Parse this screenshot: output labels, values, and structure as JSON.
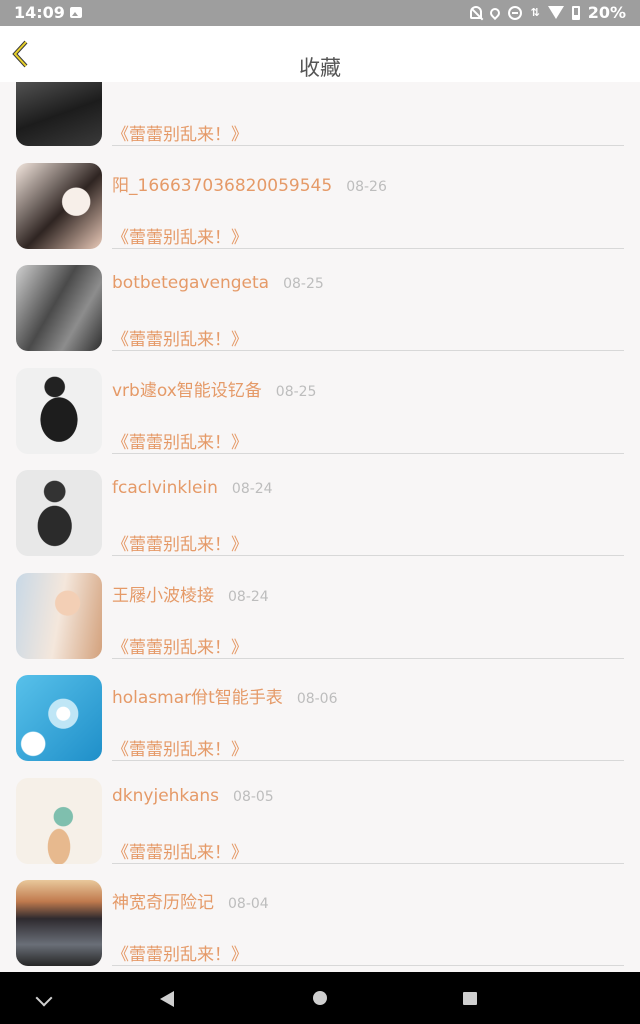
{
  "status": {
    "time": "14:09",
    "battery": "20%"
  },
  "header": {
    "title": "收藏"
  },
  "items": [
    {
      "name": "",
      "date": "",
      "link": "《蕾蕾别乱来！》",
      "avatar_colors": [
        "#2b2b2b",
        "#5a5a5a"
      ]
    },
    {
      "name": "阳_166637036820059545",
      "date": "08-26",
      "link": "《蕾蕾别乱来！》",
      "avatar_colors": [
        "#f1e6df",
        "#3a2e2b"
      ]
    },
    {
      "name": "botbetegavengeta",
      "date": "08-25",
      "link": "《蕾蕾别乱来！》",
      "avatar_colors": [
        "#cfcfcf",
        "#3d3d3d"
      ]
    },
    {
      "name": "vrb遽ox智能设钇备",
      "date": "08-25",
      "link": "《蕾蕾别乱来！》",
      "avatar_colors": [
        "#f2f2f2",
        "#1f1f1f"
      ]
    },
    {
      "name": "fcaclvinklein",
      "date": "08-24",
      "link": "《蕾蕾别乱来！》",
      "avatar_colors": [
        "#e9e9e9",
        "#2a2a2a"
      ]
    },
    {
      "name": "王屦小波棱接",
      "date": "08-24",
      "link": "《蕾蕾别乱来！》",
      "avatar_colors": [
        "#d9e4ee",
        "#e3b18d"
      ]
    },
    {
      "name": "holasmar佾t智能手表",
      "date": "08-06",
      "link": "《蕾蕾别乱来！》",
      "avatar_colors": [
        "#46b3e3",
        "#e9f6fb"
      ]
    },
    {
      "name": "dknyjehkans",
      "date": "08-05",
      "link": "《蕾蕾别乱来！》",
      "avatar_colors": [
        "#f5efe6",
        "#7cb7a8"
      ]
    },
    {
      "name": "神宽奇历险记",
      "date": "08-04",
      "link": "《蕾蕾别乱来！》",
      "avatar_colors": [
        "#5b3b2e",
        "#e8c8a0"
      ]
    }
  ]
}
